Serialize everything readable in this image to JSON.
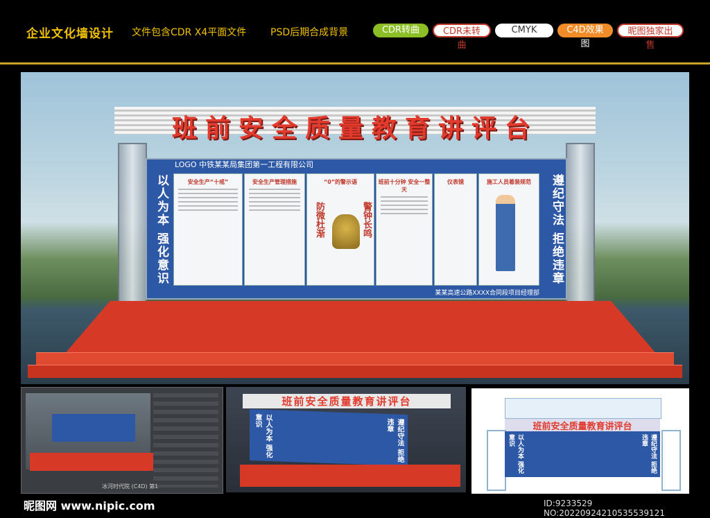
{
  "header": {
    "title": "企业文化墙设计",
    "subtitle": "文件包含CDR X4平面文件",
    "subtitle2": "PSD后期合成背景",
    "tags": [
      "CDR转曲",
      "CDR未转曲",
      "CMYK",
      "C4D效果图",
      "昵图独家出售"
    ]
  },
  "scene": {
    "title": "班前安全质量教育讲评台",
    "board_header": "LOGO   中铁某某局集团第一工程有限公司",
    "left_slogan": "以人为本  强化意识",
    "right_slogan": "遵纪守法  拒绝违章",
    "footer": "某某高速公路XXXX合同段项目经理部",
    "panels": [
      "安全生产“十戒”",
      "安全生产管理措施",
      "“0”的警示语",
      "班前十分钟 安全一整天",
      "仪表镜",
      "施工人员着装规范"
    ],
    "bell_left": "防微杜渐",
    "bell_right": "警钟长鸣"
  },
  "thumb1": {
    "caption": "冰河时代院 (C4D)  第1"
  },
  "thumb2": {
    "title": "班前安全质量教育讲评台",
    "left": "以人为本 强化意识",
    "right": "遵纪守法 拒绝违章"
  },
  "thumb3": {
    "title": "班前安全质量教育讲评台",
    "left": "以人为本 强化意识",
    "right": "遵纪守法 拒绝违章"
  },
  "watermark": {
    "logo": "昵图网 www.nipic.com",
    "id": "ID:9233529 NO:20220924210535539121"
  }
}
